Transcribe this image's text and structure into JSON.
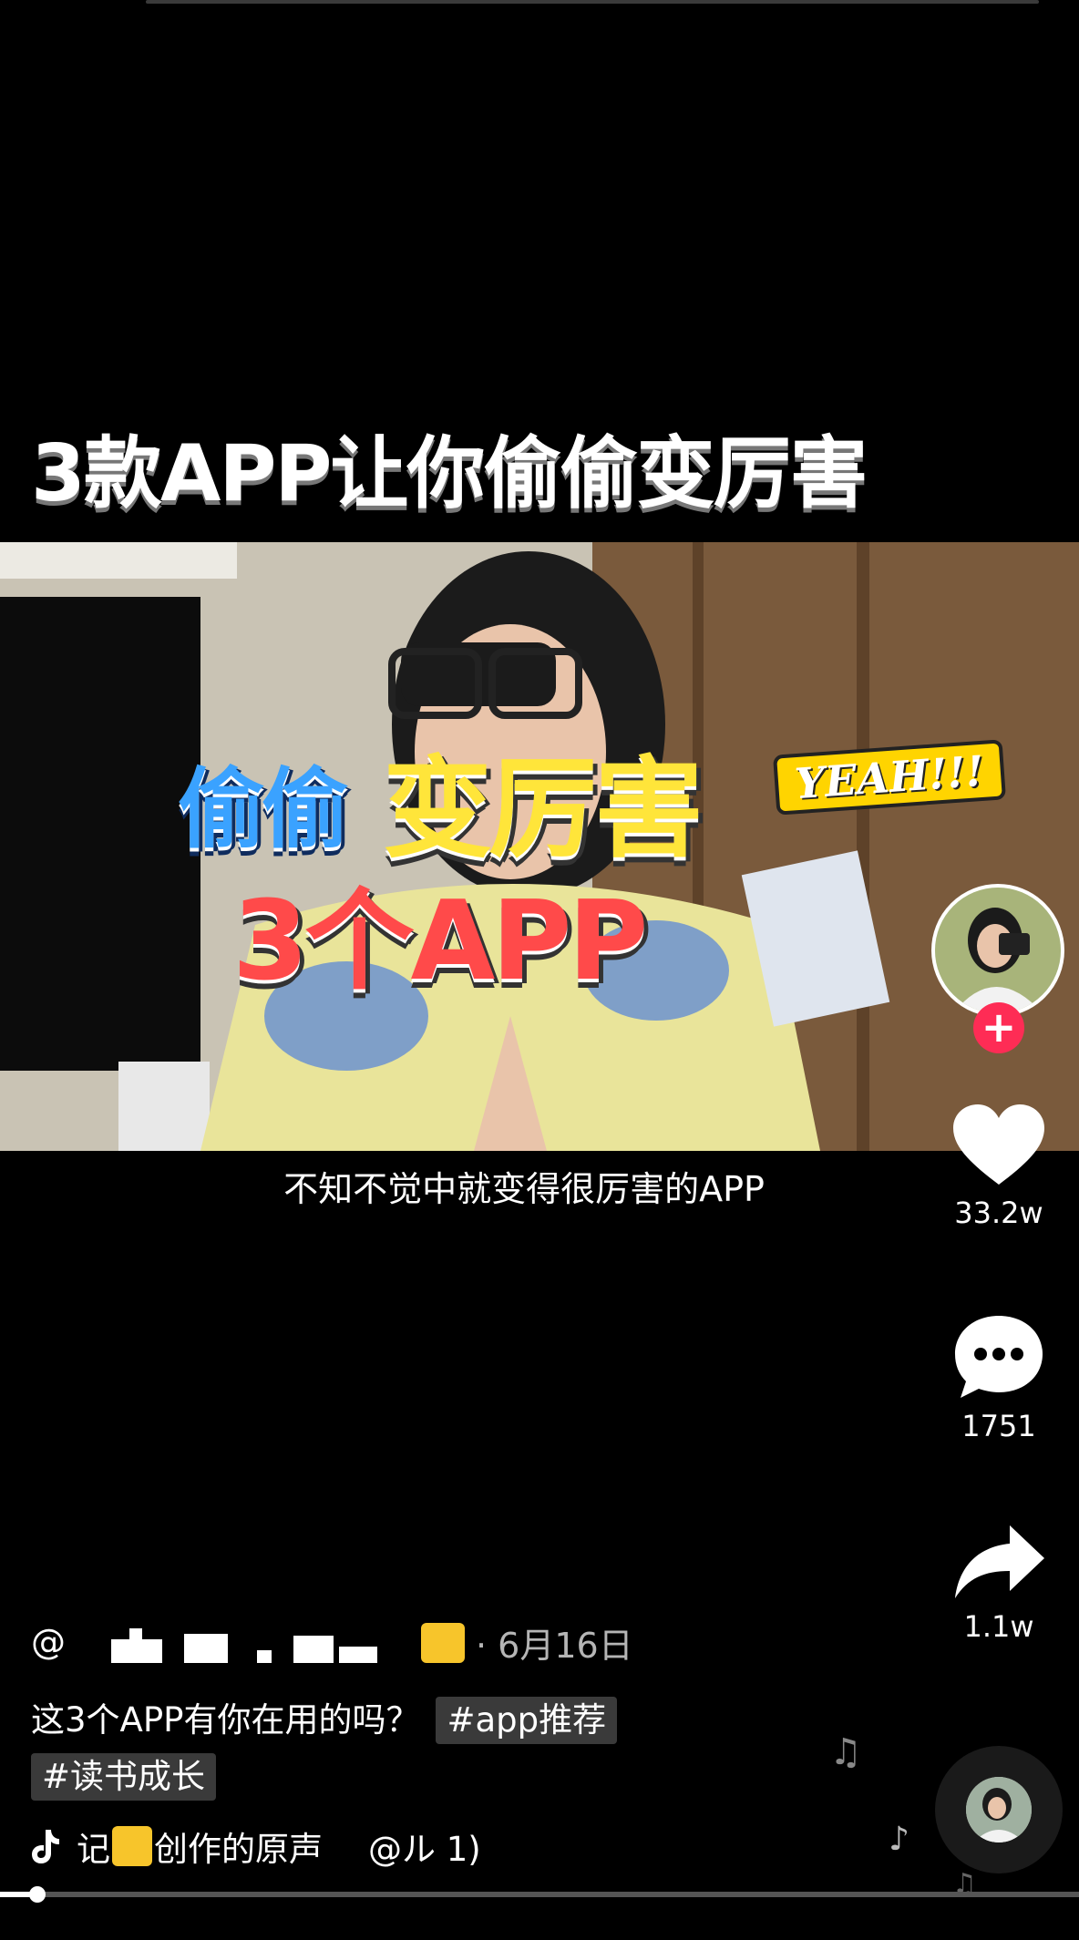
{
  "headline": "3款APP让你偷偷变厉害",
  "video_overlay": {
    "line1_blue": "偷偷",
    "line1_yellow": "变厉害",
    "yeah": "YEAH!!!",
    "line2": "3个APP"
  },
  "subtitle": "不知不觉中就变得很厉害的APP",
  "rail": {
    "follow": "+",
    "likes": "33.2w",
    "comments": "1751",
    "shares": "1.1w"
  },
  "author": {
    "at": "@",
    "date": "· 6月16日"
  },
  "caption": {
    "text": "这3个APP有你在用的吗？",
    "tags": [
      "#app推荐",
      "#读书成长"
    ]
  },
  "music": {
    "prefix": "记",
    "suffix": "创作的原声",
    "author": "@ル  1)"
  },
  "playback": {
    "progress": 0.035
  },
  "colors": {
    "accent": "#fe2c55",
    "overlay_yellow": "#ffe53a",
    "overlay_red": "#ff4a4a",
    "overlay_blue": "#3aa2ff"
  }
}
